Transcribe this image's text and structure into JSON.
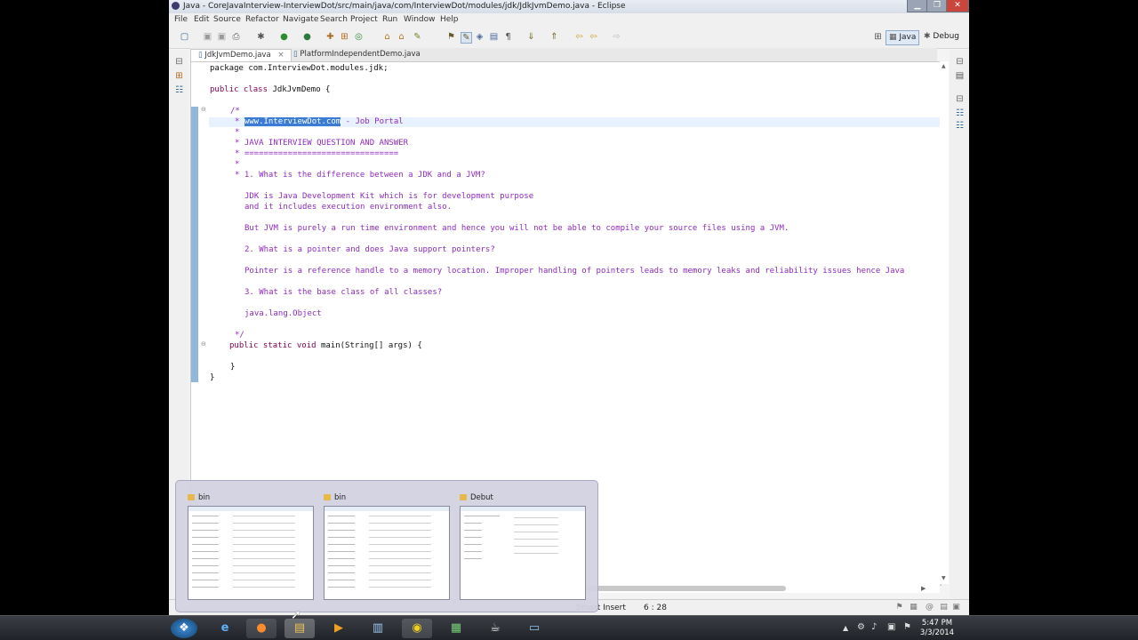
{
  "window": {
    "title": "Java - CoreJavaInterview-InterviewDot/src/main/java/com/InterviewDot/modules/jdk/JdkJvmDemo.java - Eclipse",
    "controls": [
      "minimize",
      "restore",
      "close"
    ]
  },
  "menu": [
    "File",
    "Edit",
    "Source",
    "Refactor",
    "Navigate",
    "Search",
    "Project",
    "Run",
    "Window",
    "Help"
  ],
  "perspectives": [
    "Java",
    "Debug"
  ],
  "editor_tabs": [
    {
      "label": "JdkJvmDemo.java",
      "active": true,
      "close": "×"
    },
    {
      "label": "PlatformIndependentDemo.java",
      "active": false
    }
  ],
  "code": {
    "l1": "package com.InterviewDot.modules.jdk;",
    "l2_kw": "public class",
    "l2_rest": " JdkJvmDemo {",
    "c_open": "/*",
    "c_link": "www.InterviewDot.com",
    "c_portal": " - Job Portal",
    "c_star": "*",
    "c_title": "* JAVA INTERVIEW QUESTION AND ANSWER",
    "c_rule": "* ================================",
    "c_q1": "* 1. What is the difference between a JDK and a JVM?",
    "c_a1a": "JDK is Java Development Kit which is for development purpose",
    "c_a1b": "and it includes execution environment also.",
    "c_a1c": "But JVM is purely a run time environment and hence you will not be able to compile your source files using a JVM.",
    "c_q2": "2. What is a pointer and does Java support pointers?",
    "c_a2": "Pointer is a reference handle to a memory location. Improper handling of pointers leads to memory leaks and reliability issues hence Java",
    "c_q3": "3. What is the base class of all classes?",
    "c_a3": "java.lang.Object",
    "c_close": "*/",
    "main_kw": "public static void",
    "main_rest": " main(String[] args) {",
    "brace1": "}",
    "brace2": "}"
  },
  "status": {
    "insert_mode": "Smart Insert",
    "cursor_pos": "6 : 28"
  },
  "taskbar_preview": [
    {
      "label": "bin"
    },
    {
      "label": "bin"
    },
    {
      "label": "Debut"
    }
  ],
  "clock": {
    "time": "5:47 PM",
    "date": "3/3/2014"
  },
  "colors": {
    "keyword": "#7f0055",
    "comment": "#8f2bbf",
    "selection": "#3a7bd5",
    "taskbar": "#2a2e33"
  }
}
